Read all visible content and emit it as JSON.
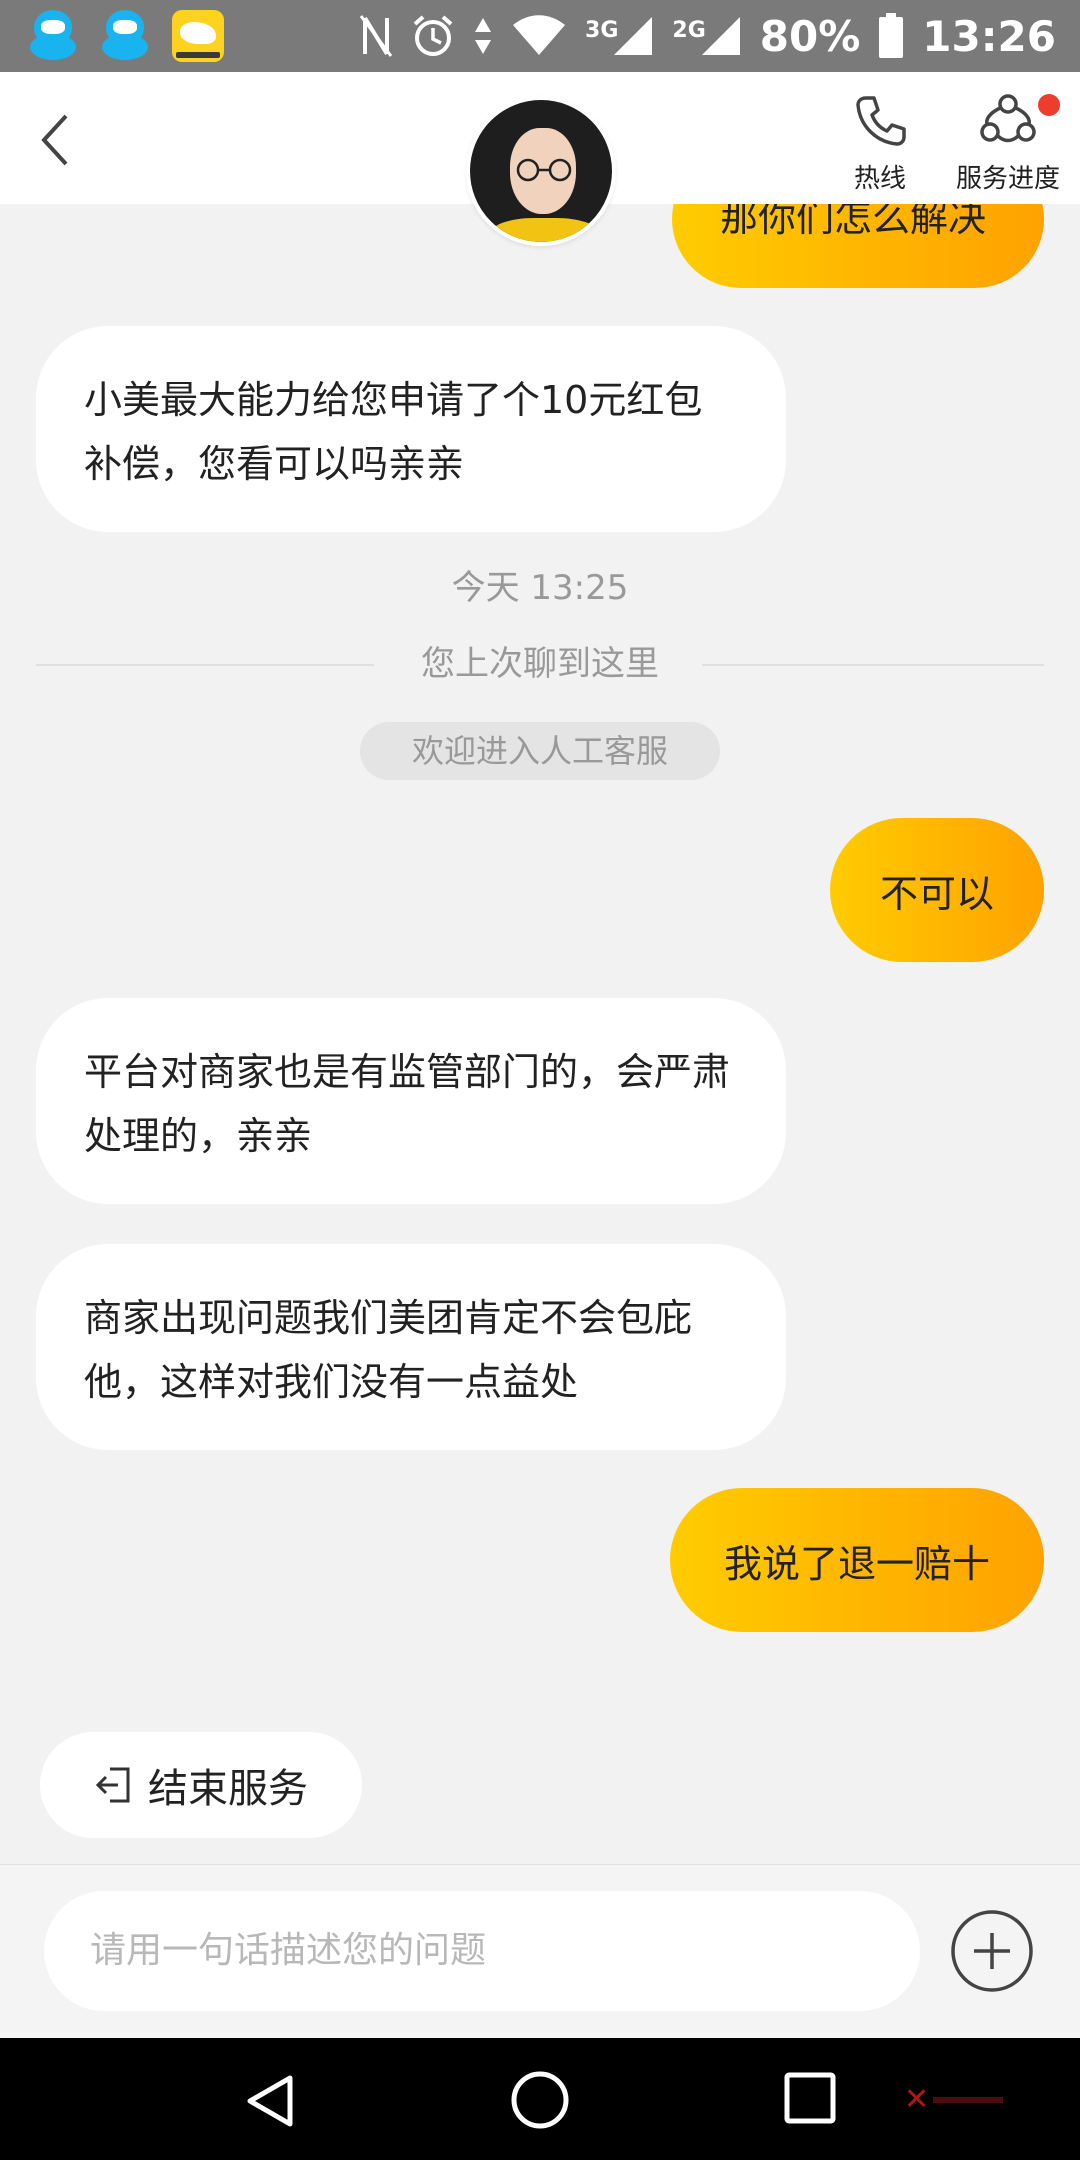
{
  "status_bar": {
    "battery": "80%",
    "time": "13:26",
    "net1": "3G",
    "net2": "2G",
    "icons": [
      "qq-icon",
      "qq-icon",
      "meituan-app-icon",
      "nfc-icon",
      "alarm-icon",
      "data-arrows-icon",
      "wifi-icon",
      "signal-icon",
      "signal-icon",
      "battery-icon"
    ]
  },
  "header": {
    "hotline_label": "热线",
    "progress_label": "服务进度"
  },
  "messages": {
    "top_partial": "那你们怎么解决",
    "msg1": "小美最大能力给您申请了个10元红包补偿，您看可以吗亲亲",
    "timestamp": "今天 13:25",
    "last_chat": "您上次聊到这里",
    "welcome": "欢迎进入人工客服",
    "user1": "不可以",
    "msg2": "平台对商家也是有监管部门的，会严肃处理的，亲亲",
    "msg3": "商家出现问题我们美团肯定不会包庇他，这样对我们没有一点益处",
    "user2": "我说了退一赔十"
  },
  "end_service": {
    "label": "结束服务"
  },
  "input": {
    "placeholder": "请用一句话描述您的问题"
  },
  "colors": {
    "bubble_start": "#ffcc00",
    "bubble_end": "#ffa200",
    "badge": "#f03c2c"
  }
}
